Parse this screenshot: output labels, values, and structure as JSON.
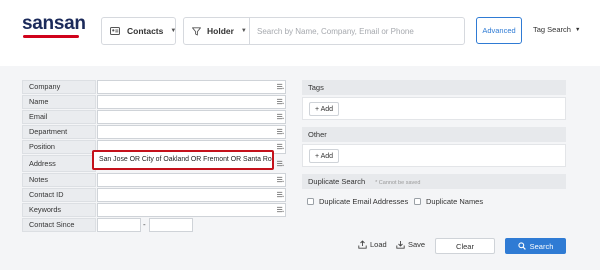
{
  "header": {
    "logo_text": "sansan",
    "contacts_select": {
      "label": "Contacts",
      "icon": "card-icon"
    },
    "holder_select": {
      "label": "Holder",
      "icon": "filter-icon"
    },
    "search": {
      "placeholder": "Search by Name, Company, Email or Phone",
      "value": ""
    },
    "advanced_label": "Advanced",
    "tag_search_label": "Tag Search"
  },
  "form": {
    "fields": [
      {
        "label": "Company",
        "value": ""
      },
      {
        "label": "Name",
        "value": ""
      },
      {
        "label": "Email",
        "value": ""
      },
      {
        "label": "Department",
        "value": ""
      },
      {
        "label": "Position",
        "value": ""
      },
      {
        "label": "Address",
        "value": "San Jose OR City of Oakland OR Fremont OR Santa Ros"
      },
      {
        "label": "Notes",
        "value": ""
      },
      {
        "label": "Contact ID",
        "value": ""
      },
      {
        "label": "Keywords",
        "value": ""
      }
    ],
    "contact_since": {
      "label": "Contact Since",
      "from": "",
      "to": "",
      "separator": "-"
    }
  },
  "tags": {
    "title": "Tags",
    "add_label": "+ Add"
  },
  "other": {
    "title": "Other",
    "add_label": "+ Add"
  },
  "duplicate": {
    "title": "Duplicate Search",
    "hint": "* Cannot be saved",
    "options": [
      "Duplicate Email Addresses",
      "Duplicate Names"
    ]
  },
  "actions": {
    "load_label": "Load",
    "save_label": "Save",
    "clear_label": "Clear",
    "search_label": "Search"
  },
  "colors": {
    "accent": "#2f7bd4",
    "brand_red": "#d0021b",
    "highlight": "#c4111b"
  }
}
